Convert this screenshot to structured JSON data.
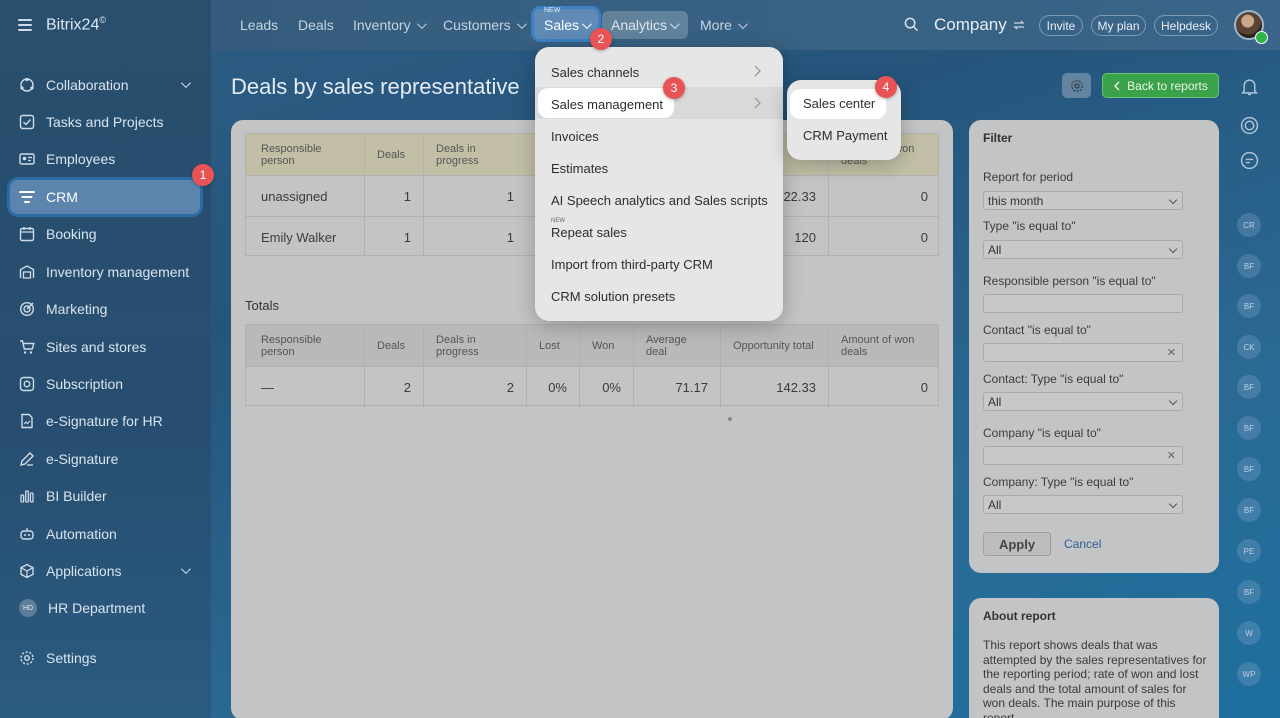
{
  "app": {
    "logo": "Bitrix24",
    "logo_sup": "©"
  },
  "sidebar": {
    "items": [
      {
        "label": "Collaboration"
      },
      {
        "label": "Tasks and Projects"
      },
      {
        "label": "Employees"
      },
      {
        "label": "CRM"
      },
      {
        "label": "Booking"
      },
      {
        "label": "Inventory management"
      },
      {
        "label": "Marketing"
      },
      {
        "label": "Sites and stores"
      },
      {
        "label": "Subscription"
      },
      {
        "label": "e-Signature for HR"
      },
      {
        "label": "e-Signature"
      },
      {
        "label": "BI Builder"
      },
      {
        "label": "Automation"
      },
      {
        "label": "Applications"
      },
      {
        "label": "HR Department",
        "badge": "HD"
      },
      {
        "label": "Settings"
      }
    ]
  },
  "topnav": {
    "leads": "Leads",
    "deals": "Deals",
    "inventory": "Inventory",
    "customers": "Customers",
    "sales_new": "NEW",
    "sales": "Sales",
    "analytics": "Analytics",
    "more": "More",
    "company": "Company",
    "invite": "Invite",
    "my_plan": "My plan",
    "helpdesk": "Helpdesk"
  },
  "page": {
    "title": "Deals by sales representative",
    "back": "Back to reports"
  },
  "report_table": {
    "headers": [
      "Responsible person",
      "Deals",
      "Deals in progress",
      "",
      "",
      "",
      "",
      "Amount of won deals"
    ],
    "rows": [
      {
        "person": "unassigned",
        "deals": "1",
        "in_progress": "1",
        "opportunity": "22.33",
        "won_amount": "0"
      },
      {
        "person": "Emily Walker",
        "deals": "1",
        "in_progress": "1",
        "opportunity": "120",
        "won_amount": "0"
      }
    ]
  },
  "totals": {
    "label": "Totals",
    "headers": [
      "Responsible person",
      "Deals",
      "Deals in progress",
      "Lost",
      "Won",
      "Average deal",
      "Opportunity total",
      "Amount of won deals"
    ],
    "row": [
      "—",
      "2",
      "2",
      "0%",
      "0%",
      "71.17",
      "142.33",
      "0"
    ]
  },
  "sales_menu": {
    "items": [
      "Sales channels",
      "Sales management",
      "Invoices",
      "Estimates",
      "AI Speech analytics and Sales scripts",
      "Repeat sales",
      "Import from third-party CRM",
      "CRM solution presets"
    ],
    "repeat_badge": "NEW"
  },
  "submenu": {
    "items": [
      "Sales center",
      "CRM Payment"
    ]
  },
  "callouts": [
    "1",
    "2",
    "3",
    "4"
  ],
  "filter": {
    "title": "Filter",
    "fields": [
      {
        "label": "Report for period",
        "value": "this month"
      },
      {
        "label": "Type \"is equal to\"",
        "value": "All"
      },
      {
        "label": "Responsible person \"is equal to\"",
        "value": ""
      },
      {
        "label": "Contact \"is equal to\"",
        "value": ""
      },
      {
        "label": "Contact: Type \"is equal to\"",
        "value": "All"
      },
      {
        "label": "Company \"is equal to\"",
        "value": ""
      },
      {
        "label": "Company: Type \"is equal to\"",
        "value": "All"
      }
    ],
    "apply": "Apply",
    "cancel": "Cancel"
  },
  "about": {
    "title": "About report",
    "text": "This report shows deals that was attempted by the sales representatives for the reporting period; rate of won and lost deals and the total amount of sales for won deals. The main purpose of this report"
  },
  "right_avatars": [
    "CR",
    "BF",
    "BF",
    "CK",
    "BF",
    "BF",
    "BF",
    "BF",
    "PE",
    "BF",
    "W",
    "WP"
  ]
}
